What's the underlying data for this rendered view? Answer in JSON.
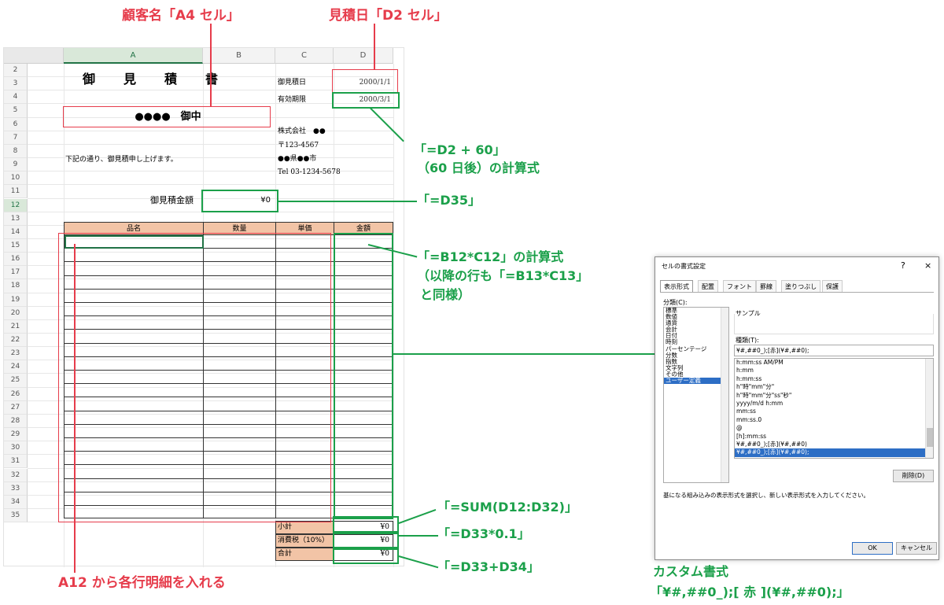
{
  "annotations": {
    "customer_cell": "顧客名「A4 セル」",
    "quote_date_cell": "見積日「D2 セル」",
    "d3_formula_1": "「=D2 + 60」",
    "d3_formula_2": "（60 日後）の計算式",
    "b9_formula": "「=D35」",
    "d12_formula_1": "「=B12*C12」の計算式",
    "d12_formula_2": "（以降の行も「=B13*C13」",
    "d12_formula_3": "と同様）",
    "d33_formula": "「=SUM(D12:D32)」",
    "d34_formula": "「=D33*0.1」",
    "d35_formula": "「=D33+D34」",
    "a12_note": "A12 から各行明細を入れる",
    "custom_format_1": "カスタム書式",
    "custom_format_2": "「¥#,##0_);[ 赤 ](¥#,##0);」"
  },
  "sheet": {
    "columns": [
      "A",
      "B",
      "C",
      "D"
    ],
    "rows": [
      "2",
      "3",
      "4",
      "5",
      "6",
      "7",
      "8",
      "9",
      "10",
      "11",
      "12",
      "13",
      "14",
      "15",
      "16",
      "17",
      "18",
      "19",
      "20",
      "21",
      "22",
      "23",
      "24",
      "25",
      "26",
      "27",
      "28",
      "29",
      "30",
      "31",
      "32",
      "33",
      "34",
      "35"
    ],
    "title": "御　見　積　書",
    "quote_date_label": "御見積日",
    "quote_date_value": "2000/1/1",
    "valid_label": "有効期限",
    "valid_value": "2000/3/1",
    "customer": "●●●●　御中",
    "company": "株式会社　●●",
    "postal": "〒123-4567",
    "address": "●●県●●市",
    "tel": "Tel 03-1234-5678",
    "intro": "下記の通り、御見積申し上げます。",
    "total_label": "御見積金額",
    "total_value": "¥0",
    "headers": [
      "品名",
      "数量",
      "単価",
      "金額"
    ],
    "subtotal_label": "小計",
    "subtotal_value": "¥0",
    "tax_label": "消費税（10%）",
    "tax_value": "¥0",
    "grand_label": "合計",
    "grand_value": "¥0"
  },
  "dialog": {
    "title": "セルの書式設定",
    "help": "?",
    "close": "×",
    "tabs": [
      "表示形式",
      "配置",
      "フォント",
      "罫線",
      "塗りつぶし",
      "保護"
    ],
    "category_label": "分類(C):",
    "categories": [
      "標準",
      "数値",
      "通貨",
      "会計",
      "日付",
      "時刻",
      "パーセンテージ",
      "分数",
      "指数",
      "文字列",
      "その他",
      "ユーザー定義"
    ],
    "sample_label": "サンプル",
    "type_label": "種類(T):",
    "type_value": "¥#,##0_);[赤](¥#,##0);",
    "formats": [
      "h:mm:ss AM/PM",
      "h:mm",
      "h:mm:ss",
      "h\"時\"mm\"分\"",
      "h\"時\"mm\"分\"ss\"秒\"",
      "yyyy/m/d h:mm",
      "mm:ss",
      "mm:ss.0",
      "@",
      "[h]:mm:ss",
      "¥#,##0_);[赤](¥#,##0)",
      "¥#,##0_);[赤](¥#,##0);"
    ],
    "delete_button": "削除(D)",
    "hint": "基になる組み込みの表示形式を選択し、新しい表示形式を入力してください。",
    "ok_button": "OK",
    "cancel_button": "キャンセル"
  },
  "colors": {
    "red": "#e63c4b",
    "green": "#1ba04a",
    "header_fill": "#f2c4a6",
    "selection": "#2d6ec5"
  }
}
